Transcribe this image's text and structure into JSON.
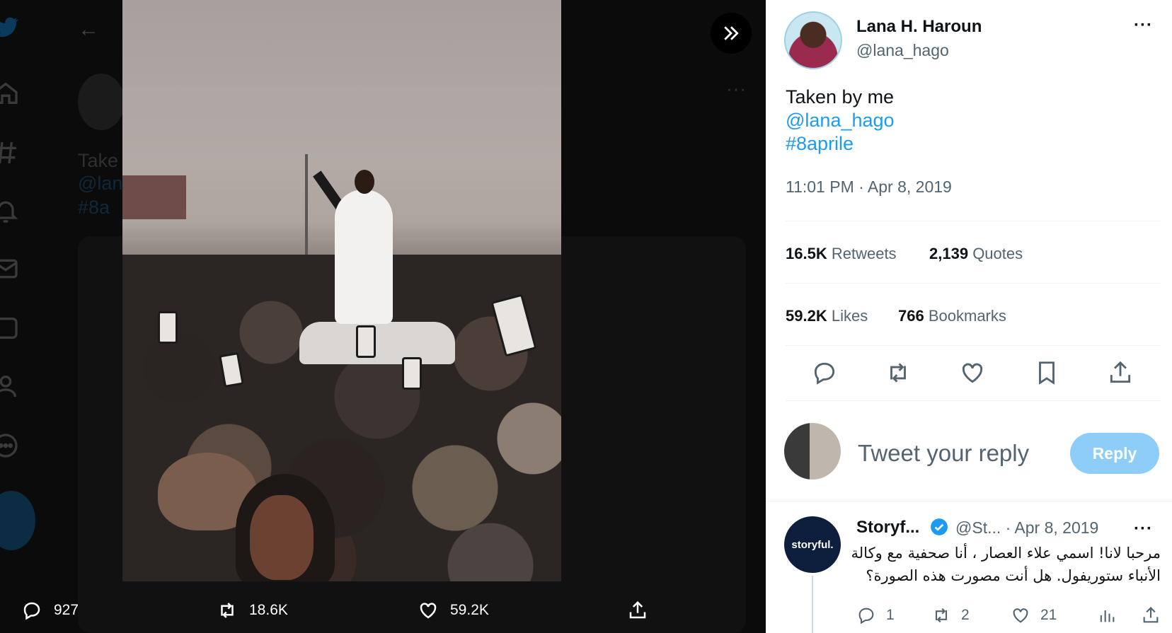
{
  "media": {
    "actions": {
      "replies": "927",
      "retweets": "18.6K",
      "likes": "59.2K"
    }
  },
  "background": {
    "text_line1": "Take",
    "text_line2": "@lan",
    "text_line3": "#8a"
  },
  "author": {
    "name": "Lana H. Haroun",
    "handle": "@lana_hago"
  },
  "tweet": {
    "line1": "Taken by me",
    "line2": "@lana_hago",
    "line3": "#8aprile",
    "timestamp": "11:01 PM · Apr 8, 2019"
  },
  "stats": {
    "retweets_count": "16.5K",
    "retweets_label": "Retweets",
    "quotes_count": "2,139",
    "quotes_label": "Quotes",
    "likes_count": "59.2K",
    "likes_label": "Likes",
    "bookmarks_count": "766",
    "bookmarks_label": "Bookmarks"
  },
  "reply_box": {
    "placeholder": "Tweet your reply",
    "button": "Reply"
  },
  "reply": {
    "avatar_text": "storyful.",
    "name": "Storyf...",
    "handle_date": "@St... · Apr 8, 2019",
    "line1": "مرحبا لانا! اسمي علاء العصار ، أنا صحفية مع وكالة",
    "line2": "الأنباء ستوريفول. هل أنت مصورت هذه الصورة؟",
    "replies": "1",
    "retweets": "2",
    "likes": "21"
  },
  "colors": {
    "accent": "#1d9bf0",
    "reply_button": "#8ecdf8",
    "text_primary": "#0f1419",
    "text_secondary": "#536471"
  }
}
